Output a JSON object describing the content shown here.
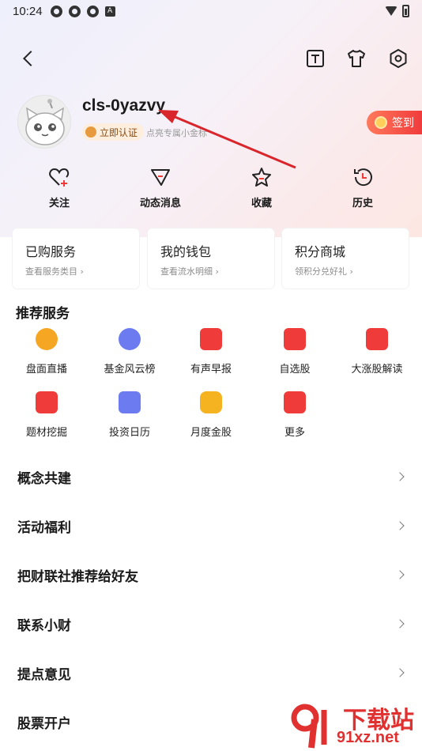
{
  "status_bar": {
    "time": "10:24",
    "badge": "A"
  },
  "profile": {
    "username": "cls-0yazvy",
    "verify_label": "立即认证",
    "hint": "点亮专属小金标",
    "signin_label": "签到"
  },
  "quick_actions": [
    {
      "label": "关注",
      "icon": "heart-plus-icon"
    },
    {
      "label": "动态消息",
      "icon": "message-icon"
    },
    {
      "label": "收藏",
      "icon": "star-icon"
    },
    {
      "label": "历史",
      "icon": "history-icon"
    }
  ],
  "cards": [
    {
      "title": "已购服务",
      "subtitle": "查看服务类目 ›"
    },
    {
      "title": "我的钱包",
      "subtitle": "查看流水明细 ›"
    },
    {
      "title": "积分商城",
      "subtitle": "领积分兑好礼 ›"
    }
  ],
  "services": {
    "title": "推荐服务",
    "items": [
      {
        "label": "盘面直播",
        "icon": "live-icon",
        "color": "#f5a623"
      },
      {
        "label": "基金风云榜",
        "icon": "trophy-icon",
        "color": "#6c7cf0"
      },
      {
        "label": "有声早报",
        "icon": "tv-icon",
        "color": "#f03b3b"
      },
      {
        "label": "自选股",
        "icon": "heart-house-icon",
        "color": "#f03b3b"
      },
      {
        "label": "大涨股解读",
        "icon": "chart-board-icon",
        "color": "#f03b3b"
      },
      {
        "label": "题材挖掘",
        "icon": "clipboard-search-icon",
        "color": "#f03b3b"
      },
      {
        "label": "投资日历",
        "icon": "calendar-icon",
        "color": "#6c7cf0"
      },
      {
        "label": "月度金股",
        "icon": "gold-hexagon-icon",
        "color": "#f5b321"
      },
      {
        "label": "更多",
        "icon": "more-grid-icon",
        "color": "#f03b3b"
      }
    ]
  },
  "menu": [
    {
      "label": "概念共建"
    },
    {
      "label": "活动福利"
    },
    {
      "label": "把财联社推荐给好友"
    },
    {
      "label": "联系小财"
    },
    {
      "label": "提点意见"
    },
    {
      "label": "股票开户"
    }
  ],
  "watermark": {
    "line1": "下载站",
    "line2": "91xz.net"
  },
  "colors": {
    "accent": "#f03b3b",
    "gold": "#f5b321"
  }
}
